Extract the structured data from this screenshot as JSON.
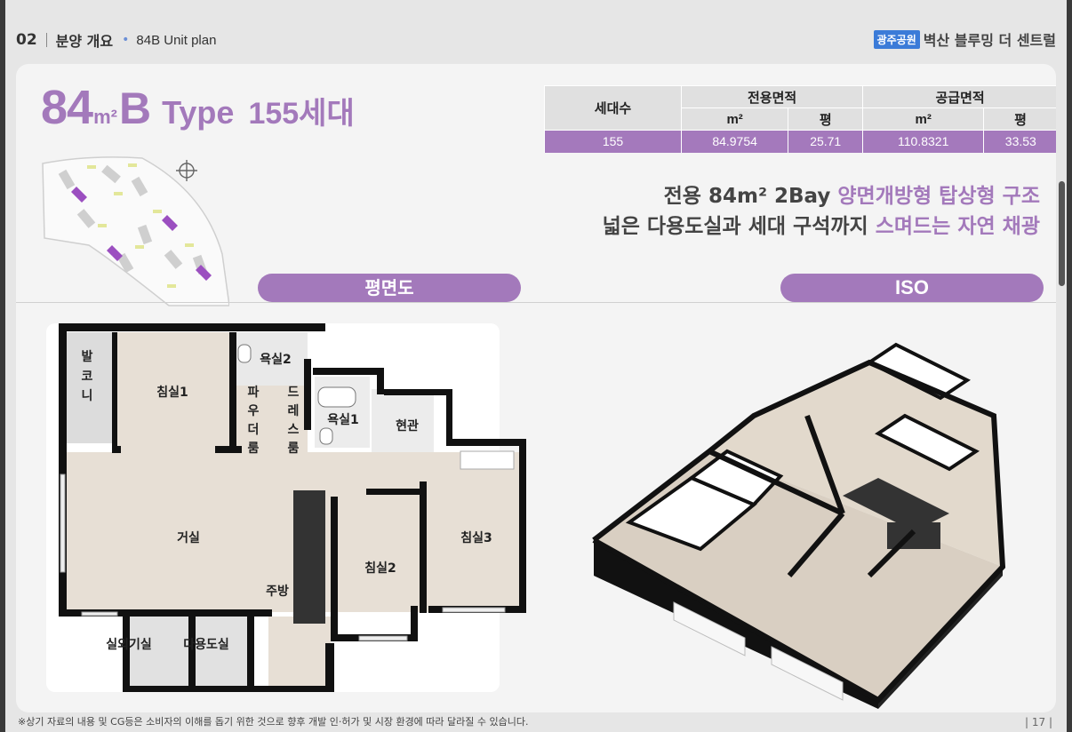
{
  "header": {
    "section_number": "02",
    "section_title": "분양 개요",
    "subtitle": "84B Unit plan",
    "brand_badge": "광주공원",
    "brand_name": "벽산 블루밍 더 센트럴"
  },
  "unit": {
    "area": "84",
    "unit_sup": "m²",
    "letter": "B",
    "type_word": "Type",
    "households": "155세대"
  },
  "table": {
    "col_households": "세대수",
    "col_exclusive": "전용면적",
    "col_supply": "공급면적",
    "m2": "m²",
    "pyeong": "평",
    "values": [
      "155",
      "84.9754",
      "25.71",
      "110.8321",
      "33.53"
    ]
  },
  "tagline": {
    "line1_prefix": "전용 84m² 2Bay ",
    "line1_accent": "양면개방형 탑상형 구조",
    "line2_prefix": "넓은 다용도실과 세대 구석까지 ",
    "line2_accent": "스며드는 자연 채광"
  },
  "sections": {
    "plan_label": "평면도",
    "iso_label": "ISO"
  },
  "rooms": {
    "balcony": [
      "발",
      "코",
      "니"
    ],
    "bedroom1": "침실1",
    "bath2": "욕실2",
    "powder": [
      "파",
      "우",
      "더",
      "룸"
    ],
    "dress": [
      "드",
      "레",
      "스",
      "룸"
    ],
    "bath1": "욕실1",
    "entrance": "현관",
    "living": "거실",
    "bedroom3": "침실3",
    "bedroom2": "침실2",
    "kitchen": "주방",
    "outdoor_unit": "실외기실",
    "utility": "다용도실"
  },
  "footer": {
    "disclaimer": "※상기 자료의 내용 및 CG등은 소비자의 이해를 돕기 위한 것으로 향후 개발 인·허가 및 시장 환경에 따라 달라질 수 있습니다.",
    "page": "| 17 |"
  },
  "colors": {
    "accent": "#a379bb",
    "brand_blue": "#3b7bd8"
  }
}
